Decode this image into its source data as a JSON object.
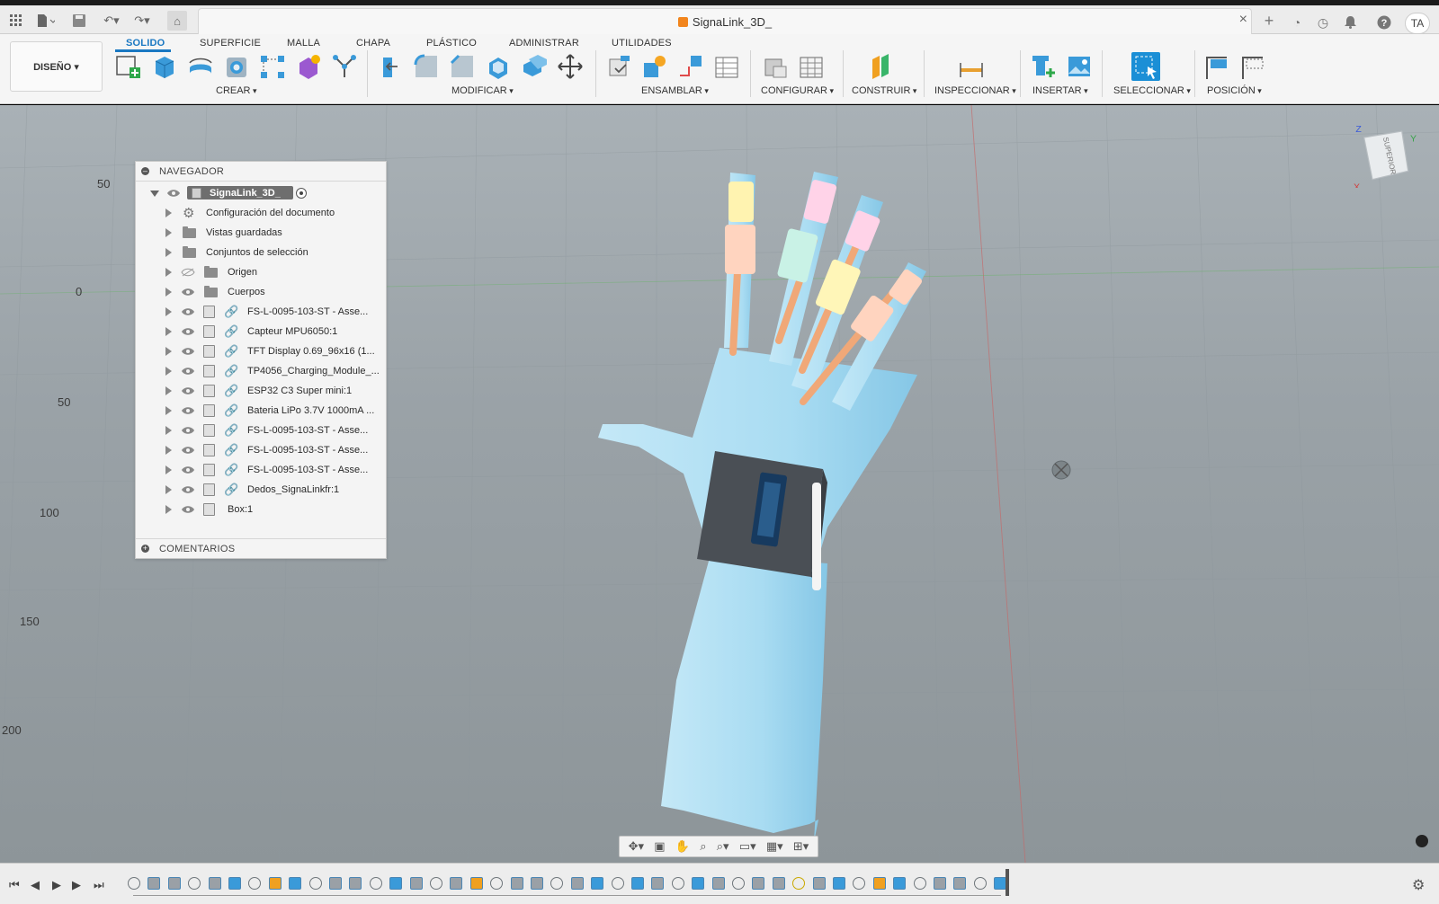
{
  "app": {
    "document_title": "SignaLink_3D_",
    "user_initials": "TA"
  },
  "workspace": {
    "label": "DISEÑO ▾"
  },
  "tabs": [
    {
      "label": "SOLIDO",
      "active": true
    },
    {
      "label": "SUPERFICIE"
    },
    {
      "label": "MALLA"
    },
    {
      "label": "CHAPA"
    },
    {
      "label": "PLÁSTICO"
    },
    {
      "label": "ADMINISTRAR"
    },
    {
      "label": "UTILIDADES"
    }
  ],
  "groups": {
    "crear": "CREAR",
    "modificar": "MODIFICAR",
    "ensamblar": "ENSAMBLAR",
    "configurar": "CONFIGURAR",
    "construir": "CONSTRUIR",
    "inspeccionar": "INSPECCIONAR",
    "insertar": "INSERTAR",
    "seleccionar": "SELECCIONAR",
    "posicion": "POSICIÓN"
  },
  "browser": {
    "header": "NAVEGADOR",
    "footer": "COMENTARIOS",
    "root": "SignaLink_3D_",
    "items": [
      {
        "label": "Configuración del documento",
        "icon": "gear-icon"
      },
      {
        "label": "Vistas guardadas",
        "icon": "folder-icon"
      },
      {
        "label": "Conjuntos de selección",
        "icon": "folder-icon"
      },
      {
        "label": "Origen",
        "icon": "folder-icon"
      },
      {
        "label": "Cuerpos",
        "icon": "folder-icon"
      },
      {
        "label": "FS-L-0095-103-ST - Asse...",
        "icon": "component-link-icon"
      },
      {
        "label": "Capteur MPU6050:1",
        "icon": "component-link-icon"
      },
      {
        "label": "TFT Display 0.69_96x16 (1...",
        "icon": "component-link-icon"
      },
      {
        "label": "TP4056_Charging_Module_...",
        "icon": "component-link-icon"
      },
      {
        "label": "ESP32 C3 Super mini:1",
        "icon": "component-link-icon"
      },
      {
        "label": "Bateria LiPo 3.7V 1000mA ...",
        "icon": "component-link-icon"
      },
      {
        "label": "FS-L-0095-103-ST - Asse...",
        "icon": "component-link-icon"
      },
      {
        "label": "FS-L-0095-103-ST - Asse...",
        "icon": "component-link-icon"
      },
      {
        "label": "FS-L-0095-103-ST - Asse...",
        "icon": "component-link-icon"
      },
      {
        "label": "Dedos_SignaLinkfr:1",
        "icon": "component-link-icon"
      },
      {
        "label": "Box:1",
        "icon": "component-icon"
      }
    ]
  },
  "grid_labels": [
    "50",
    "0",
    "50",
    "100",
    "150",
    "200"
  ],
  "viewcube": {
    "face": "SUPERIOR",
    "axes": [
      "Z",
      "Y",
      "X"
    ]
  },
  "colors": {
    "accent": "#1a78c2",
    "hand": "#a9dcf2",
    "finger_rod": "#f0a878",
    "box": "#4a4f55"
  }
}
